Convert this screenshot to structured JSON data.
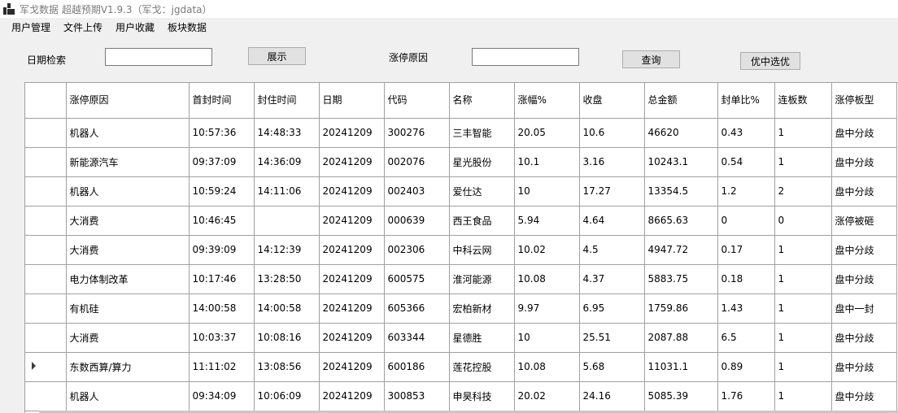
{
  "window": {
    "title": "军戈数据 超越预期V1.9.3（军戈：jgdata）"
  },
  "menu": [
    "用户管理",
    "文件上传",
    "用户收藏",
    "板块数据"
  ],
  "filters": {
    "date_label": "日期检索",
    "date_value": "",
    "show_button": "展示",
    "reason_label": "涨停原因",
    "reason_value": "",
    "query_button": "查询",
    "pick_button": "优中选优"
  },
  "table": {
    "columns": [
      "涨停原因",
      "首封时间",
      "封住时间",
      "日期",
      "代码",
      "名称",
      "涨幅%",
      "收盘",
      "总金额",
      "封单比%",
      "连板数",
      "涨停板型"
    ],
    "selected_row": 8,
    "rows": [
      [
        "机器人",
        "10:57:36",
        "14:48:33",
        "20241209",
        "300276",
        "三丰智能",
        "20.05",
        "10.6",
        "46620",
        "0.43",
        "1",
        "盘中分歧"
      ],
      [
        "新能源汽车",
        "09:37:09",
        "14:36:09",
        "20241209",
        "002076",
        "星光股份",
        "10.1",
        "3.16",
        "10243.1",
        "0.54",
        "1",
        "盘中分歧"
      ],
      [
        "机器人",
        "10:59:24",
        "14:11:06",
        "20241209",
        "002403",
        "爱仕达",
        "10",
        "17.27",
        "13354.5",
        "1.2",
        "2",
        "盘中分歧"
      ],
      [
        "大消费",
        "10:46:45",
        "",
        "20241209",
        "000639",
        "西王食品",
        "5.94",
        "4.64",
        "8665.63",
        "0",
        "0",
        "涨停被砸"
      ],
      [
        "大消费",
        "09:39:09",
        "14:12:39",
        "20241209",
        "002306",
        "中科云网",
        "10.02",
        "4.5",
        "4947.72",
        "0.17",
        "1",
        "盘中分歧"
      ],
      [
        "电力体制改革",
        "10:17:46",
        "13:28:50",
        "20241209",
        "600575",
        "淮河能源",
        "10.08",
        "4.37",
        "5883.75",
        "0.18",
        "1",
        "盘中分歧"
      ],
      [
        "有机硅",
        "14:00:58",
        "14:00:58",
        "20241209",
        "605366",
        "宏柏新材",
        "9.97",
        "6.95",
        "1759.86",
        "1.43",
        "1",
        "盘中一封"
      ],
      [
        "大消费",
        "10:03:37",
        "10:08:16",
        "20241209",
        "603344",
        "星德胜",
        "10",
        "25.51",
        "2087.88",
        "6.5",
        "1",
        "盘中分歧"
      ],
      [
        "东数西算/算力",
        "11:11:02",
        "13:08:56",
        "20241209",
        "600186",
        "莲花控股",
        "10.08",
        "5.68",
        "11031.1",
        "0.89",
        "1",
        "盘中分歧"
      ],
      [
        "机器人",
        "09:34:09",
        "10:06:09",
        "20241209",
        "300853",
        "申昊科技",
        "20.02",
        "24.16",
        "5085.39",
        "1.76",
        "1",
        "盘中分歧"
      ]
    ]
  }
}
